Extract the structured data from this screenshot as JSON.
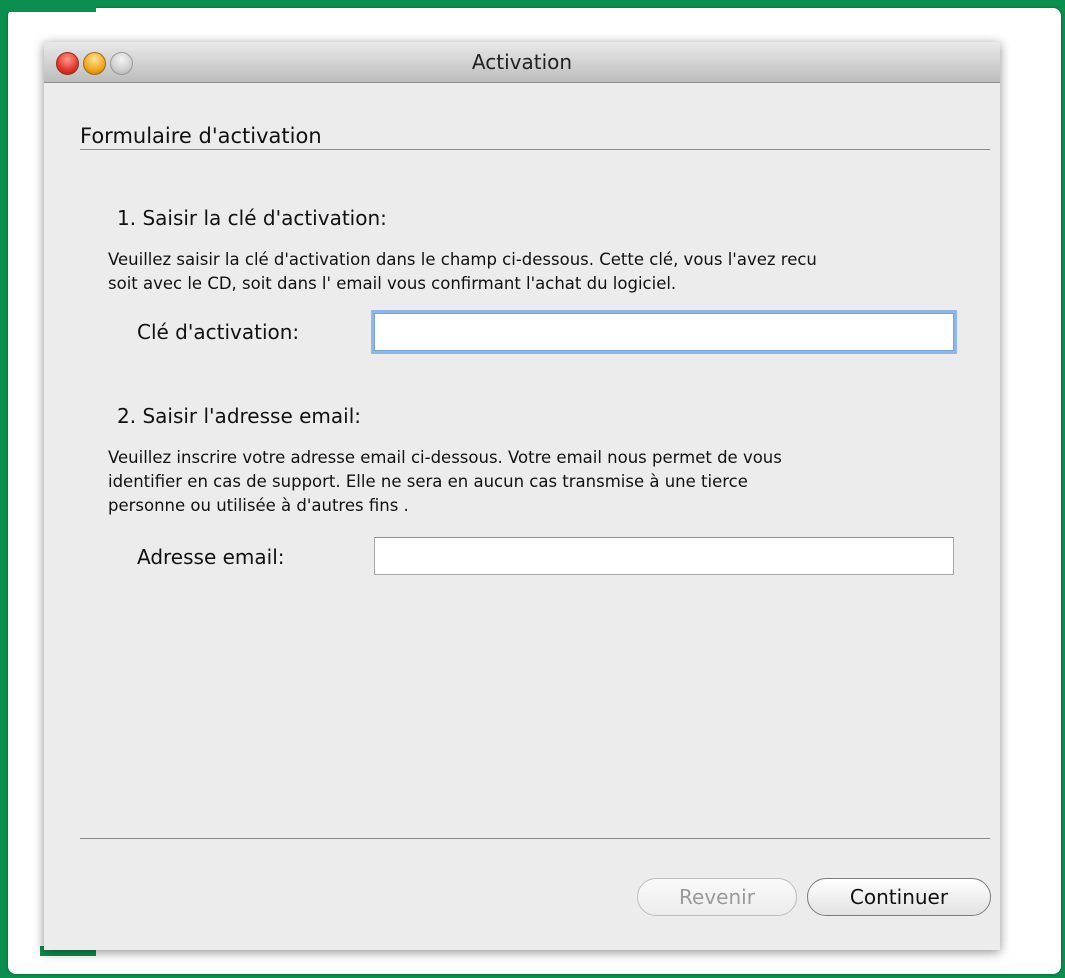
{
  "window": {
    "title": "Activation"
  },
  "form": {
    "section_title": "Formulaire d'activation",
    "step1": {
      "heading": "1. Saisir la clé d'activation:",
      "desc_line1": "Veuillez saisir la clé d'activation dans le champ ci-dessous. Cette clé, vous l'avez recu",
      "desc_line2": "soit avec le CD, soit dans l' email vous confirmant l'achat du logiciel.",
      "field_label": "Clé d'activation:",
      "field_value": ""
    },
    "step2": {
      "heading": "2. Saisir l'adresse email:",
      "desc_line1": "Veuillez inscrire votre adresse email ci-dessous. Votre email nous permet de vous",
      "desc_line2": "identifier en cas de support. Elle ne sera en aucun cas transmise à une tierce",
      "desc_line3": "personne ou utilisée à d'autres fins .",
      "field_label": "Adresse email:",
      "field_value": ""
    }
  },
  "buttons": {
    "back_label": "Revenir",
    "continue_label": "Continuer"
  },
  "colors": {
    "background_green": "#0b8f4e",
    "window_body": "#ececec",
    "focus_ring": "#8fb7e8"
  }
}
